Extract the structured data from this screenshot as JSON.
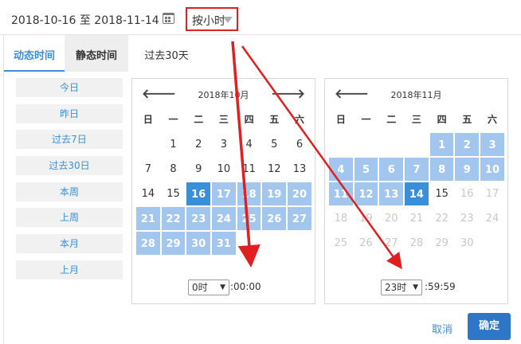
{
  "date_range": {
    "start": "2018-10-16",
    "separator": "至",
    "end": "2018-11-14"
  },
  "mode_select": {
    "value": "按小时"
  },
  "tabs": [
    "动态时间",
    "静态时间",
    "过去30天"
  ],
  "quick_ranges": [
    "今日",
    "昨日",
    "过去7日",
    "过去30日",
    "本周",
    "上周",
    "本月",
    "上月"
  ],
  "weekdays": [
    "日",
    "一",
    "二",
    "三",
    "四",
    "五",
    "六"
  ],
  "calendars": [
    {
      "title": "2018年10月",
      "prev": "🡐",
      "next": "🡒",
      "rows": [
        [
          "",
          "1",
          "2",
          "3",
          "4",
          "5",
          "6"
        ],
        [
          "7",
          "8",
          "9",
          "10",
          "11",
          "12",
          "13"
        ],
        [
          "14",
          "15",
          "16",
          "17",
          "18",
          "19",
          "20"
        ],
        [
          "21",
          "22",
          "23",
          "24",
          "25",
          "26",
          "27"
        ],
        [
          "28",
          "29",
          "30",
          "31",
          "",
          "",
          ""
        ]
      ],
      "hour": "0时",
      "time_suffix": ":00:00"
    },
    {
      "title": "2018年11月",
      "prev": "🡐",
      "rows": [
        [
          "",
          "",
          "",
          "",
          "1",
          "2",
          "3"
        ],
        [
          "4",
          "5",
          "6",
          "7",
          "8",
          "9",
          "10"
        ],
        [
          "11",
          "12",
          "13",
          "14",
          "15",
          "16",
          "17"
        ],
        [
          "18",
          "19",
          "20",
          "21",
          "22",
          "23",
          "24"
        ],
        [
          "25",
          "26",
          "27",
          "28",
          "29",
          "30",
          ""
        ]
      ],
      "hour": "23时",
      "time_suffix": ":59:59"
    }
  ],
  "selection": {
    "start_day": "16",
    "end_day": "14"
  },
  "footer": {
    "cancel": "取消",
    "confirm": "确定"
  },
  "colors": {
    "accent": "#3a8fd9",
    "range": "#a3c6ee",
    "highlight": "#e02020"
  },
  "icons": [
    "calendar-icon",
    "caret-down-icon",
    "arrow-left-icon",
    "arrow-right-icon"
  ]
}
